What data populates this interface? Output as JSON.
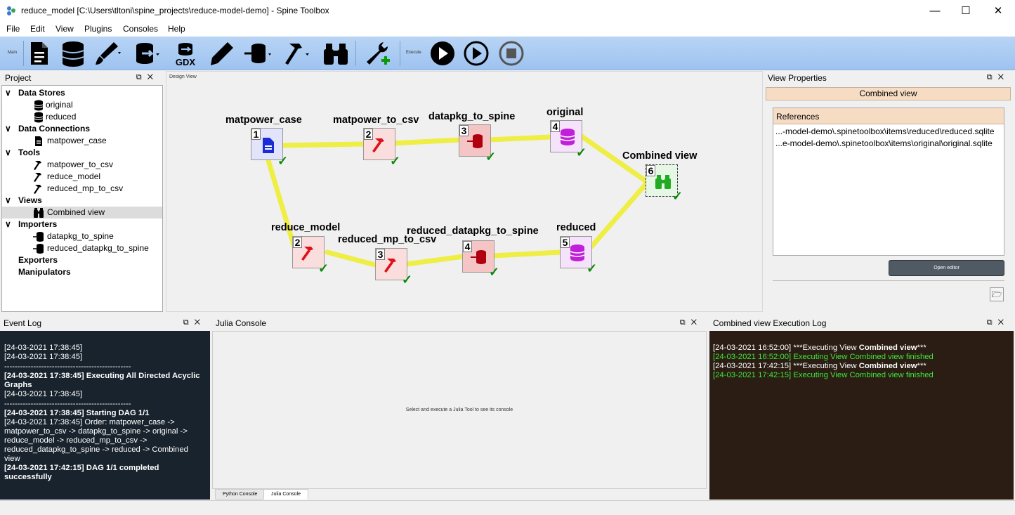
{
  "window": {
    "title": "reduce_model [C:\\Users\\tltoni\\spine_projects\\reduce-model-demo] - Spine Toolbox"
  },
  "menu": [
    "File",
    "Edit",
    "View",
    "Plugins",
    "Consoles",
    "Help"
  ],
  "toolbar": {
    "main_label": "Main",
    "execute_label": "Execute",
    "gdx_label": "GDX"
  },
  "project": {
    "title": "Project",
    "categories": [
      {
        "label": "Data Stores",
        "items": [
          "original",
          "reduced"
        ]
      },
      {
        "label": "Data Connections",
        "items": [
          "matpower_case"
        ]
      },
      {
        "label": "Tools",
        "items": [
          "matpower_to_csv",
          "reduce_model",
          "reduced_mp_to_csv"
        ]
      },
      {
        "label": "Views",
        "items": [
          "Combined view"
        ]
      },
      {
        "label": "Importers",
        "items": [
          "datapkg_to_spine",
          "reduced_datapkg_to_spine"
        ]
      },
      {
        "label": "Exporters",
        "items": []
      },
      {
        "label": "Manipulators",
        "items": []
      }
    ]
  },
  "design": {
    "label": "Design View",
    "nodes": [
      {
        "name": "matpower_case",
        "badge": "1"
      },
      {
        "name": "matpower_to_csv",
        "badge": "2"
      },
      {
        "name": "datapkg_to_spine",
        "badge": "3"
      },
      {
        "name": "original",
        "badge": "4"
      },
      {
        "name": "Combined view",
        "badge": "6"
      },
      {
        "name": "reduce_model",
        "badge": "2"
      },
      {
        "name": "reduced_mp_to_csv",
        "badge": "3"
      },
      {
        "name": "reduced_datapkg_to_spine",
        "badge": "4"
      },
      {
        "name": "reduced",
        "badge": "5"
      }
    ]
  },
  "view_properties": {
    "title": "View Properties",
    "header": "Combined view",
    "references_header": "References",
    "references": [
      "...-model-demo\\.spinetoolbox\\items\\reduced\\reduced.sqlite",
      "...e-model-demo\\.spinetoolbox\\items\\original\\original.sqlite"
    ],
    "open_editor": "Open editor"
  },
  "event_log": {
    "title": "Event Log",
    "lines": [
      "[24-03-2021 17:38:45]",
      "[24-03-2021 17:38:45]",
      "------------------------------------------------",
      "[24-03-2021 17:38:45] Executing All Directed Acyclic Graphs",
      "[24-03-2021 17:38:45]",
      "------------------------------------------------",
      "[24-03-2021 17:38:45] Starting DAG 1/1",
      "[24-03-2021 17:38:45] Order: matpower_case -> matpower_to_csv -> datapkg_to_spine -> original -> reduce_model -> reduced_mp_to_csv -> reduced_datapkg_to_spine -> reduced -> Combined view",
      "[24-03-2021 17:42:15] DAG 1/1 completed successfully"
    ]
  },
  "julia": {
    "title": "Julia Console",
    "message": "Select and execute a Julia Tool to see its console",
    "tabs": [
      "Python Console",
      "Julia Console"
    ]
  },
  "exec_log": {
    "title": "Combined view Execution Log",
    "l1_ts": "[24-03-2021 16:52:00]",
    "l1_a": "***Executing View ",
    "l1_b": "Combined view",
    "l1_c": "***",
    "l2": "[24-03-2021 16:52:00] Executing View Combined view finished",
    "l3_ts": "[24-03-2021 17:42:15]",
    "l3_a": "***Executing View ",
    "l3_b": "Combined view",
    "l3_c": "***",
    "l4": "[24-03-2021 17:42:15] Executing View Combined view finished"
  },
  "colors": {
    "accent": "#9ec3f0",
    "link": "#f5f050",
    "success": "#0a8a0a"
  }
}
